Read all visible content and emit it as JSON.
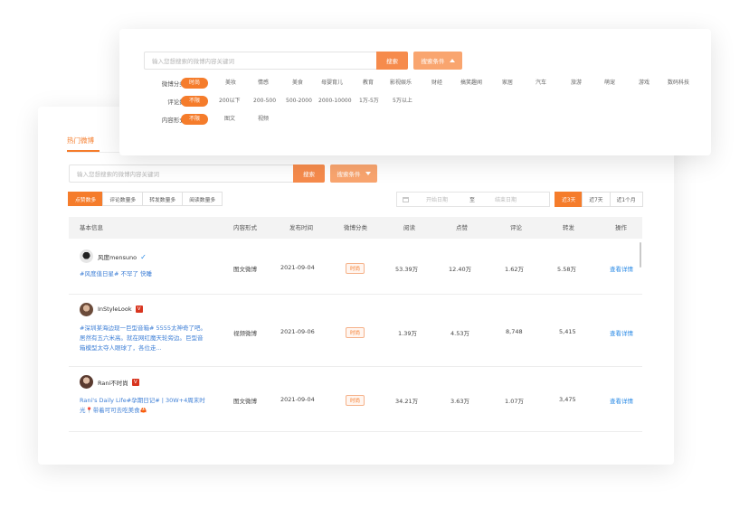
{
  "top_search": {
    "placeholder": "输入您想搜索的微博内容关键词",
    "search_label": "搜索",
    "conditions_label": "搜索条件"
  },
  "filters": {
    "category": {
      "label": "微博分类:",
      "options": [
        "时尚",
        "美妆",
        "情感",
        "美食",
        "母婴育儿",
        "教育",
        "影视娱乐",
        "财经",
        "搞笑趣闻",
        "家居",
        "汽车",
        "旅游",
        "萌宠",
        "游戏",
        "数码科技"
      ]
    },
    "comments": {
      "label": "评论数:",
      "options": [
        "不限",
        "200以下",
        "200-500",
        "500-2000",
        "2000-10000",
        "1万-5万",
        "5万以上"
      ]
    },
    "content_form": {
      "label": "内容形式:",
      "options": [
        "不限",
        "图文",
        "视频"
      ]
    }
  },
  "section": {
    "tab": "热门微博"
  },
  "inner_search": {
    "placeholder": "输入您想搜索的微博内容关键词",
    "search_label": "搜索",
    "conditions_label": "搜索条件"
  },
  "sort_buttons": [
    "点赞数多",
    "评论数量多",
    "转发数量多",
    "阅读数量多"
  ],
  "date_range": {
    "start_placeholder": "开始日期",
    "separator": "至",
    "end_placeholder": "结束日期"
  },
  "period_buttons": [
    "近3天",
    "近7天",
    "近1个月"
  ],
  "table": {
    "headers": [
      "基本信息",
      "内容形式",
      "发布时间",
      "微博分类",
      "阅读",
      "点赞",
      "评论",
      "转发",
      "操作"
    ],
    "rows": [
      {
        "user": "风度mensuno",
        "verified": "blue",
        "text": "#风度值日星# 不罕了 快睡",
        "form": "图文微博",
        "date": "2021-09-04",
        "category": "时尚",
        "reads": "53.39万",
        "likes": "12.40万",
        "comments": "1.62万",
        "reposts": "5.58万",
        "action": "查看详情"
      },
      {
        "user": "InStyleLook",
        "verified": "red",
        "text": "#深圳某海边现一巨型音箱# 5555太神奇了吧。居然有五六米高。就在网红魔天轮旁边。巨型音箱模型太夺人眼球了，各位走...",
        "form": "视频微博",
        "date": "2021-09-06",
        "category": "时尚",
        "reads": "1.39万",
        "likes": "4.53万",
        "comments": "8,748",
        "reposts": "5,415",
        "action": "查看详情"
      },
      {
        "user": "Rani不时尚",
        "verified": "red",
        "text": "Rani's Daily Life#孕期日记# | 30W+4周末时光📍带着可可去吃美食🦀",
        "form": "图文微博",
        "date": "2021-09-04",
        "category": "时尚",
        "reads": "34.21万",
        "likes": "3.63万",
        "comments": "1.07万",
        "reposts": "3,475",
        "action": "查看详情"
      }
    ]
  },
  "colors": {
    "accent": "#f57c2b",
    "link": "#2a8ae6"
  },
  "icons": [
    "verified-blue-icon",
    "verified-red-icon",
    "calendar-icon",
    "caret-up-icon",
    "caret-down-icon"
  ]
}
